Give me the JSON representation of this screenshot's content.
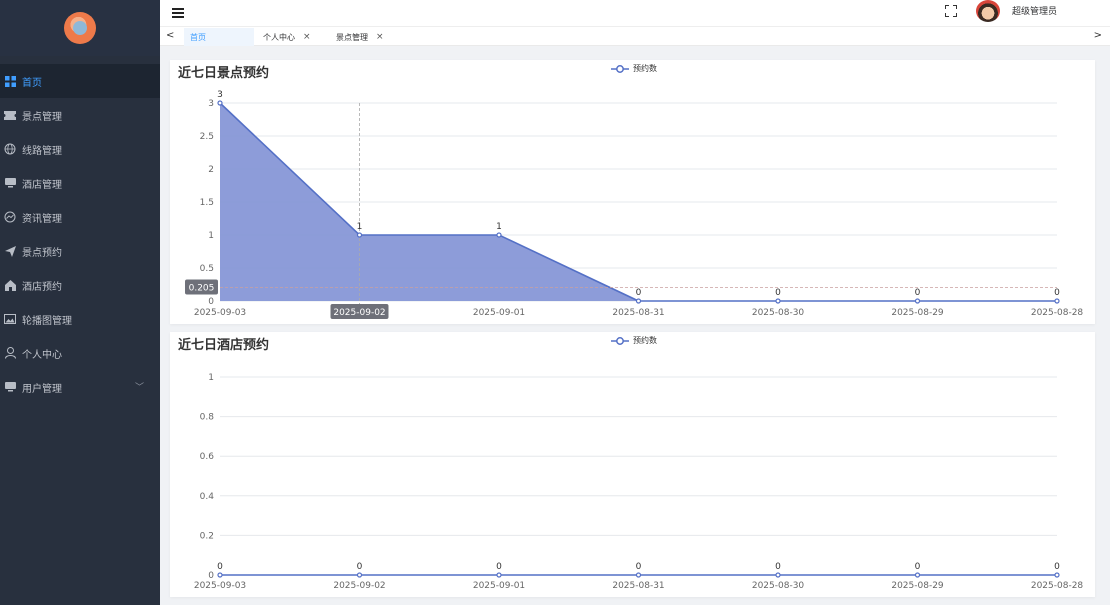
{
  "sidebar": {
    "items": [
      {
        "label": "首页",
        "icon": "grid-icon",
        "active": true
      },
      {
        "label": "景点管理",
        "icon": "ticket-icon"
      },
      {
        "label": "线路管理",
        "icon": "globe-icon"
      },
      {
        "label": "酒店管理",
        "icon": "bed-icon"
      },
      {
        "label": "资讯管理",
        "icon": "chart-icon"
      },
      {
        "label": "景点预约",
        "icon": "send-icon"
      },
      {
        "label": "酒店预约",
        "icon": "home-icon"
      },
      {
        "label": "轮播图管理",
        "icon": "image-icon"
      },
      {
        "label": "个人中心",
        "icon": "user-icon"
      },
      {
        "label": "用户管理",
        "icon": "monitor-icon",
        "has_submenu": true
      }
    ]
  },
  "header": {
    "username": "超级管理员"
  },
  "tabs": [
    {
      "label": "首页",
      "active": true
    },
    {
      "label": "个人中心",
      "closable": true
    },
    {
      "label": "景点管理",
      "closable": true
    }
  ],
  "colors": {
    "sidebar_bg": "#28303e",
    "active": "#409eff",
    "series": "#5470c6",
    "area": "#8797d7"
  },
  "chart_data": [
    {
      "type": "area",
      "title": "近七日景点预约",
      "categories": [
        "2025-09-03",
        "2025-09-02",
        "2025-09-01",
        "2025-08-31",
        "2025-08-30",
        "2025-08-29",
        "2025-08-28"
      ],
      "series": [
        {
          "name": "预约数",
          "values": [
            3,
            1,
            1,
            0,
            0,
            0,
            0
          ]
        }
      ],
      "yticks": [
        "0",
        "0.5",
        "1",
        "1.5",
        "2",
        "2.5",
        "3"
      ],
      "ylim": [
        0,
        3
      ],
      "tooltip": {
        "category": "2025-09-02",
        "y_readout": "0.205"
      },
      "grid": true,
      "legend": "top-center"
    },
    {
      "type": "line",
      "title": "近七日酒店预约",
      "categories": [
        "2025-09-03",
        "2025-09-02",
        "2025-09-01",
        "2025-08-31",
        "2025-08-30",
        "2025-08-29",
        "2025-08-28"
      ],
      "series": [
        {
          "name": "预约数",
          "values": [
            0,
            0,
            0,
            0,
            0,
            0,
            0
          ]
        }
      ],
      "yticks": [
        "0",
        "0.2",
        "0.4",
        "0.6",
        "0.8",
        "1"
      ],
      "ylim": [
        0,
        1
      ],
      "grid": true,
      "legend": "top-center"
    }
  ]
}
